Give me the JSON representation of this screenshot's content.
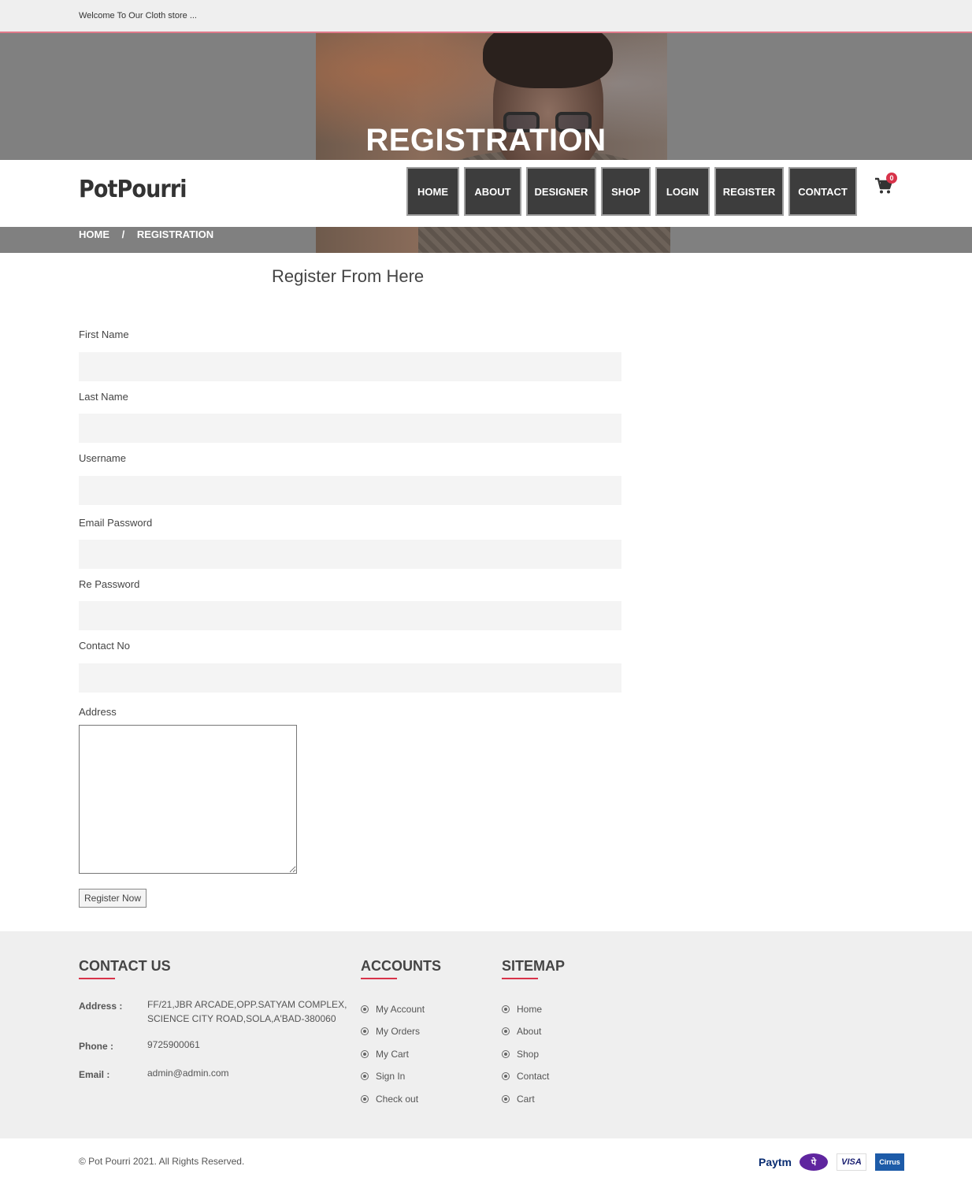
{
  "topbar": {
    "welcome": "Welcome To Our Cloth store ..."
  },
  "hero": {
    "title": "REGISTRATION"
  },
  "brand": {
    "logo": "PotPourri"
  },
  "nav": {
    "items": [
      "HOME",
      "ABOUT",
      "DESIGNER",
      "SHOP",
      "LOGIN",
      "REGISTER",
      "CONTACT"
    ],
    "cart_icon": "cart-icon",
    "cart_count": "0"
  },
  "breadcrumb": {
    "home": "HOME",
    "separator": "/",
    "current": "REGISTRATION"
  },
  "form": {
    "title": "Register From Here",
    "fields": [
      {
        "label": "First Name",
        "value": ""
      },
      {
        "label": "Last Name",
        "value": ""
      },
      {
        "label": "Username",
        "value": ""
      },
      {
        "label": "Email Password",
        "value": ""
      },
      {
        "label": "Re Password",
        "value": ""
      },
      {
        "label": "Contact No",
        "value": ""
      }
    ],
    "address_label": "Address",
    "address_value": "",
    "submit_label": "Register Now"
  },
  "footer": {
    "contact": {
      "heading": "CONTACT US",
      "address_label": "Address :",
      "address_line1": "FF/21,JBR ARCADE,OPP.SATYAM COMPLEX,",
      "address_line2": "SCIENCE CITY ROAD,SOLA,A'BAD-380060",
      "phone_label": "Phone :",
      "phone": "9725900061",
      "email_label": "Email :",
      "email": "admin@admin.com"
    },
    "accounts": {
      "heading": "ACCOUNTS",
      "links": [
        "My Account",
        "My Orders",
        "My Cart",
        "Sign In",
        "Check out"
      ]
    },
    "sitemap": {
      "heading": "SITEMAP",
      "links": [
        "Home",
        "About",
        "Shop",
        "Contact",
        "Cart"
      ]
    },
    "accent_color": "#d8334a"
  },
  "bottom": {
    "copyright": "© Pot Pourri 2021. All Rights Reserved.",
    "payments": {
      "paytm": "Paytm",
      "phonepe": "पे",
      "visa": "VISA",
      "cirrus": "Cirrus"
    }
  }
}
